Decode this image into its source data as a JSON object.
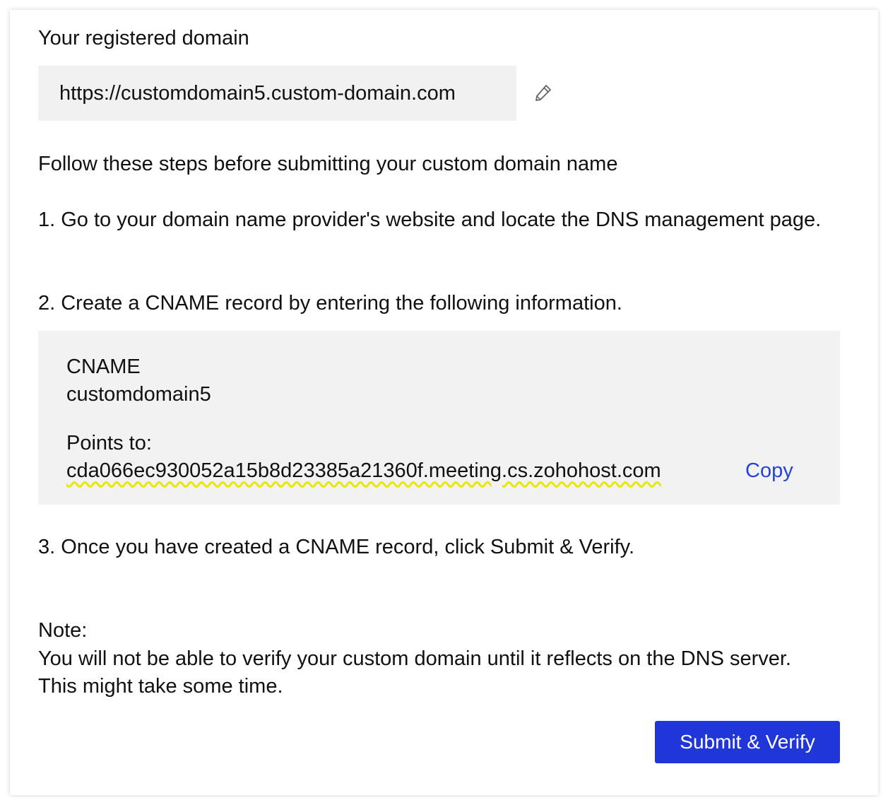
{
  "registered_domain": {
    "label": "Your registered domain",
    "value": "https://customdomain5.custom-domain.com",
    "edit_icon": "pencil-icon"
  },
  "instructions": {
    "intro": "Follow these steps before submitting your custom domain name",
    "step1": "1. Go to your domain name provider's website and locate the DNS management page.",
    "step2": "2. Create a CNAME record by entering the following information.",
    "step3": "3. Once you have created a CNAME record, click Submit & Verify."
  },
  "cname_record": {
    "cname_label": "CNAME",
    "cname_value": "customdomain5",
    "points_to_label": "Points to:",
    "points_to_value": "cda066ec930052a15b8d23385a21360f.meeting.cs.zohohost.com",
    "copy_label": "Copy"
  },
  "note": {
    "label": "Note:",
    "text": "You will not be able to verify your custom domain until it reflects on the DNS server. This might take some time."
  },
  "actions": {
    "submit_label": "Submit & Verify"
  },
  "colors": {
    "accent": "#2136d8",
    "link": "#2445d6",
    "box_background": "#f2f2f2",
    "highlight_underline": "#e8e800"
  }
}
